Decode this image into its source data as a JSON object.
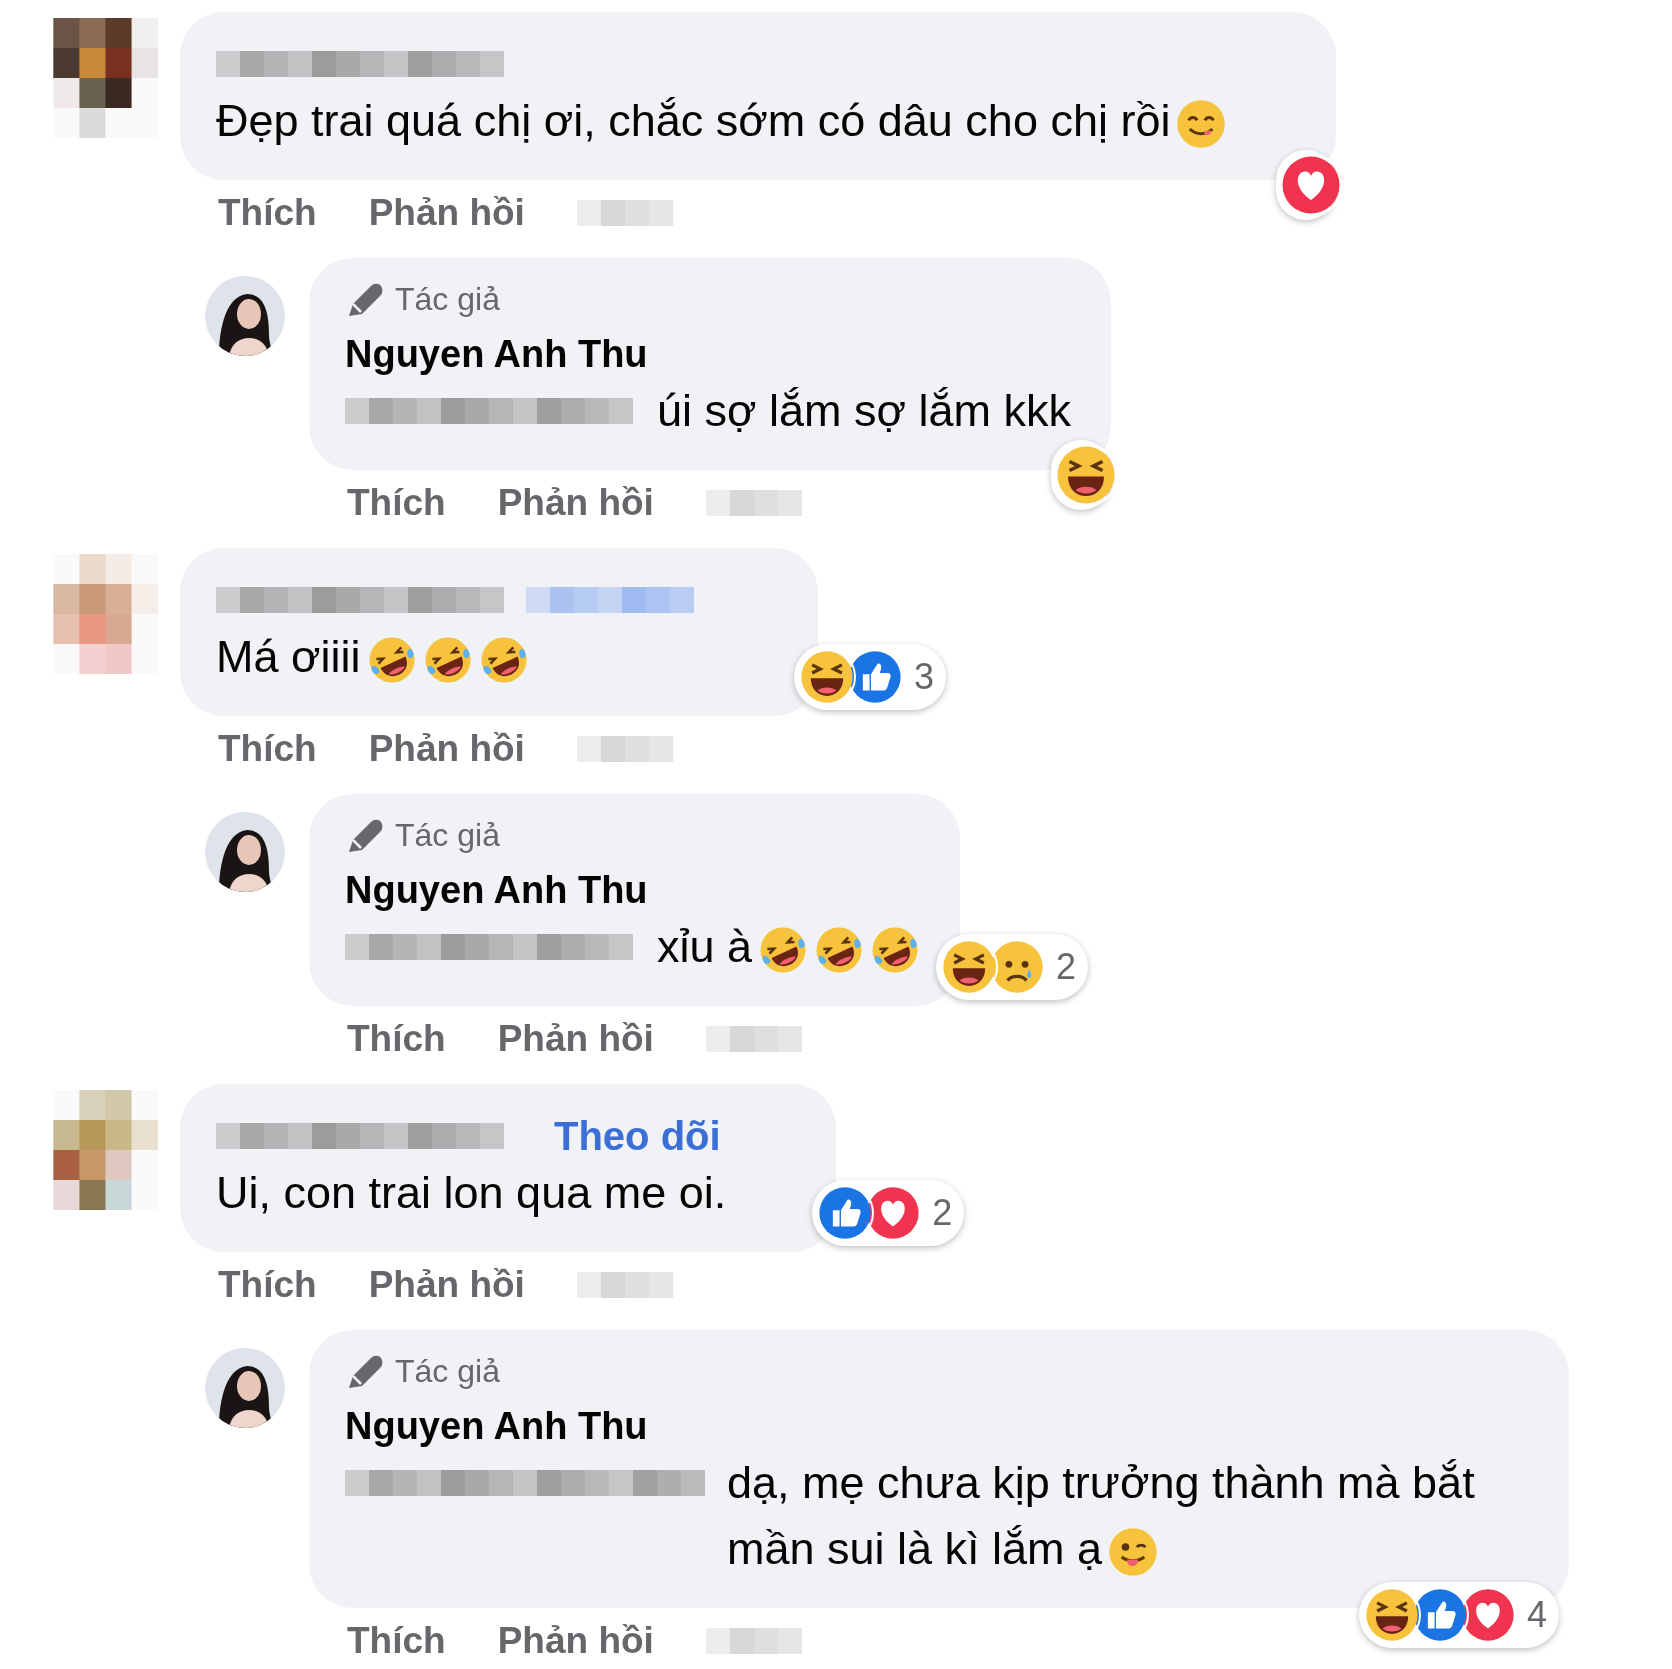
{
  "comments": [
    {
      "avatar": {
        "kind": "pixelated"
      },
      "name_blurred": true,
      "text": "Đẹp trai quá chị ơi, chắc sớm có dâu cho chị rồi",
      "trailing_emojis": [
        {
          "kind": "yum"
        }
      ],
      "reactions": {
        "types": [
          {
            "kind": "love"
          }
        ]
      },
      "actions": [
        "Thích",
        "Phản hồi"
      ],
      "time_blurred": true,
      "replies": [
        {
          "avatar": {
            "kind": "person"
          },
          "badge": "Tác giả",
          "name": "Nguyen Anh Thu",
          "text_prefix_blurred": true,
          "text": "úi sợ lắm sợ lắm kkk",
          "reactions": {
            "types": [
              {
                "kind": "haha"
              }
            ]
          },
          "actions": [
            "Thích",
            "Phản hồi"
          ],
          "time_blurred": true
        }
      ]
    },
    {
      "avatar": {
        "kind": "pixelated"
      },
      "name_blurred": true,
      "follow_blurred": true,
      "text": "Má ơiiii",
      "trailing_emojis": [
        {
          "kind": "rofl"
        },
        {
          "kind": "rofl"
        },
        {
          "kind": "rofl"
        }
      ],
      "reactions": {
        "types": [
          {
            "kind": "haha"
          },
          {
            "kind": "like"
          }
        ],
        "count": "3"
      },
      "actions": [
        "Thích",
        "Phản hồi"
      ],
      "time_blurred": true,
      "replies": [
        {
          "avatar": {
            "kind": "person"
          },
          "badge": "Tác giả",
          "name": "Nguyen Anh Thu",
          "text_prefix_blurred": true,
          "text": "xỉu à",
          "trailing_emojis": [
            {
              "kind": "rofl"
            },
            {
              "kind": "rofl"
            },
            {
              "kind": "rofl"
            }
          ],
          "reactions": {
            "types": [
              {
                "kind": "haha"
              },
              {
                "kind": "sad"
              }
            ],
            "count": "2"
          },
          "actions": [
            "Thích",
            "Phản hồi"
          ],
          "time_blurred": true
        }
      ]
    },
    {
      "avatar": {
        "kind": "pixelated"
      },
      "name_blurred": true,
      "follow": "Theo dõi",
      "text": "Ui, con trai lon qua me oi.",
      "reactions": {
        "types": [
          {
            "kind": "like"
          },
          {
            "kind": "love"
          }
        ],
        "count": "2"
      },
      "actions": [
        "Thích",
        "Phản hồi"
      ],
      "time_blurred": true,
      "replies": [
        {
          "avatar": {
            "kind": "person"
          },
          "badge": "Tác giả",
          "name": "Nguyen Anh Thu",
          "text_prefix_blurred": true,
          "text": "dạ, mẹ chưa kịp trưởng thành mà bắt mần sui là kì lắm ạ",
          "trailing_emojis": [
            {
              "kind": "zany"
            }
          ],
          "reactions": {
            "types": [
              {
                "kind": "haha"
              },
              {
                "kind": "like"
              },
              {
                "kind": "love"
              }
            ],
            "count": "4"
          },
          "actions": [
            "Thích",
            "Phản hồi"
          ],
          "time_blurred": true
        }
      ]
    }
  ]
}
